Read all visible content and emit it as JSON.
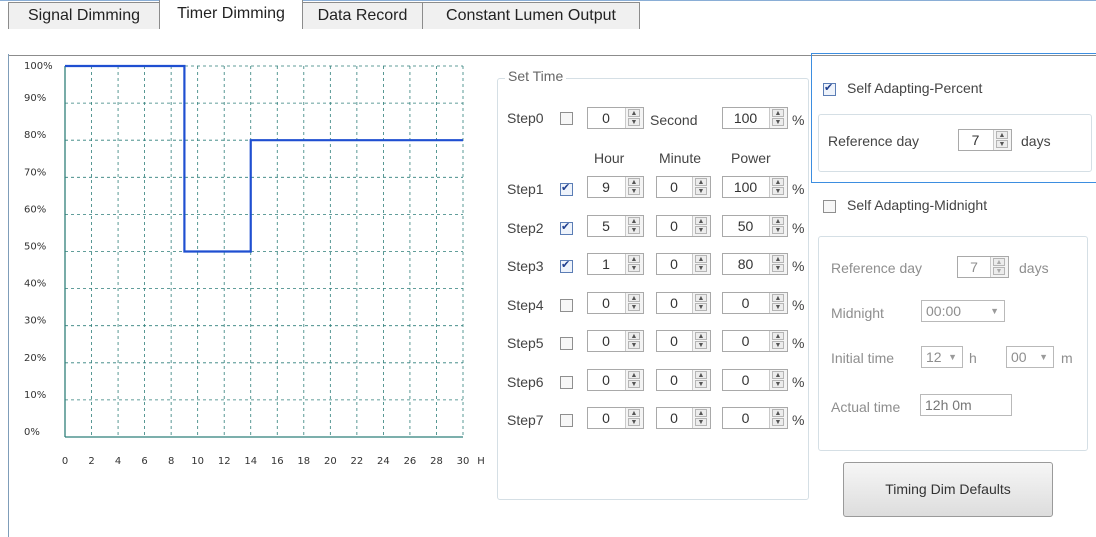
{
  "tabs": [
    {
      "label": "Signal Dimming",
      "active": false
    },
    {
      "label": "Timer Dimming",
      "active": true
    },
    {
      "label": "Data Record",
      "active": false
    },
    {
      "label": "Constant Lumen Output",
      "active": false
    }
  ],
  "chart_data": {
    "type": "line",
    "title": "",
    "xlabel": "",
    "ylabel": "",
    "x_ticks": [
      "0",
      "2",
      "4",
      "6",
      "8",
      "10",
      "12",
      "14",
      "16",
      "18",
      "20",
      "22",
      "24",
      "26",
      "28",
      "30"
    ],
    "x_unit": "H",
    "y_ticks": [
      "0%",
      "10%",
      "20%",
      "30%",
      "40%",
      "50%",
      "60%",
      "70%",
      "80%",
      "90%",
      "100%"
    ],
    "xlim": [
      0,
      30
    ],
    "ylim": [
      0,
      100
    ],
    "grid": true,
    "series": [
      {
        "color": "#1f4fd1",
        "x": [
          0,
          9,
          9,
          14,
          14,
          30
        ],
        "y": [
          100,
          100,
          50,
          50,
          80,
          80
        ]
      }
    ]
  },
  "set_time": {
    "legend": "Set Time",
    "headers": {
      "hour": "Hour",
      "minute": "Minute",
      "power": "Power"
    },
    "step0": {
      "label": "Step0",
      "checked": false,
      "seconds": "0",
      "second_label": "Second",
      "power": "100",
      "unit": "%"
    },
    "steps": [
      {
        "label": "Step1",
        "checked": true,
        "hour": "9",
        "minute": "0",
        "power": "100",
        "unit": "%"
      },
      {
        "label": "Step2",
        "checked": true,
        "hour": "5",
        "minute": "0",
        "power": "50",
        "unit": "%"
      },
      {
        "label": "Step3",
        "checked": true,
        "hour": "1",
        "minute": "0",
        "power": "80",
        "unit": "%"
      },
      {
        "label": "Step4",
        "checked": false,
        "hour": "0",
        "minute": "0",
        "power": "0",
        "unit": "%"
      },
      {
        "label": "Step5",
        "checked": false,
        "hour": "0",
        "minute": "0",
        "power": "0",
        "unit": "%"
      },
      {
        "label": "Step6",
        "checked": false,
        "hour": "0",
        "minute": "0",
        "power": "0",
        "unit": "%"
      },
      {
        "label": "Step7",
        "checked": false,
        "hour": "0",
        "minute": "0",
        "power": "0",
        "unit": "%"
      }
    ]
  },
  "self_percent": {
    "label": "Self Adapting-Percent",
    "checked": true,
    "ref_label": "Reference day",
    "ref_value": "7",
    "ref_unit": "days"
  },
  "self_midnight": {
    "label": "Self Adapting-Midnight",
    "checked": false,
    "ref_label": "Reference day",
    "ref_value": "7",
    "ref_unit": "days",
    "midnight_label": "Midnight",
    "midnight_value": "00:00",
    "initial_label": "Initial time",
    "initial_hour": "12",
    "h_label": "h",
    "initial_min": "00",
    "m_label": "m",
    "actual_label": "Actual time",
    "actual_value": "12h 0m"
  },
  "defaults_button": "Timing Dim Defaults"
}
